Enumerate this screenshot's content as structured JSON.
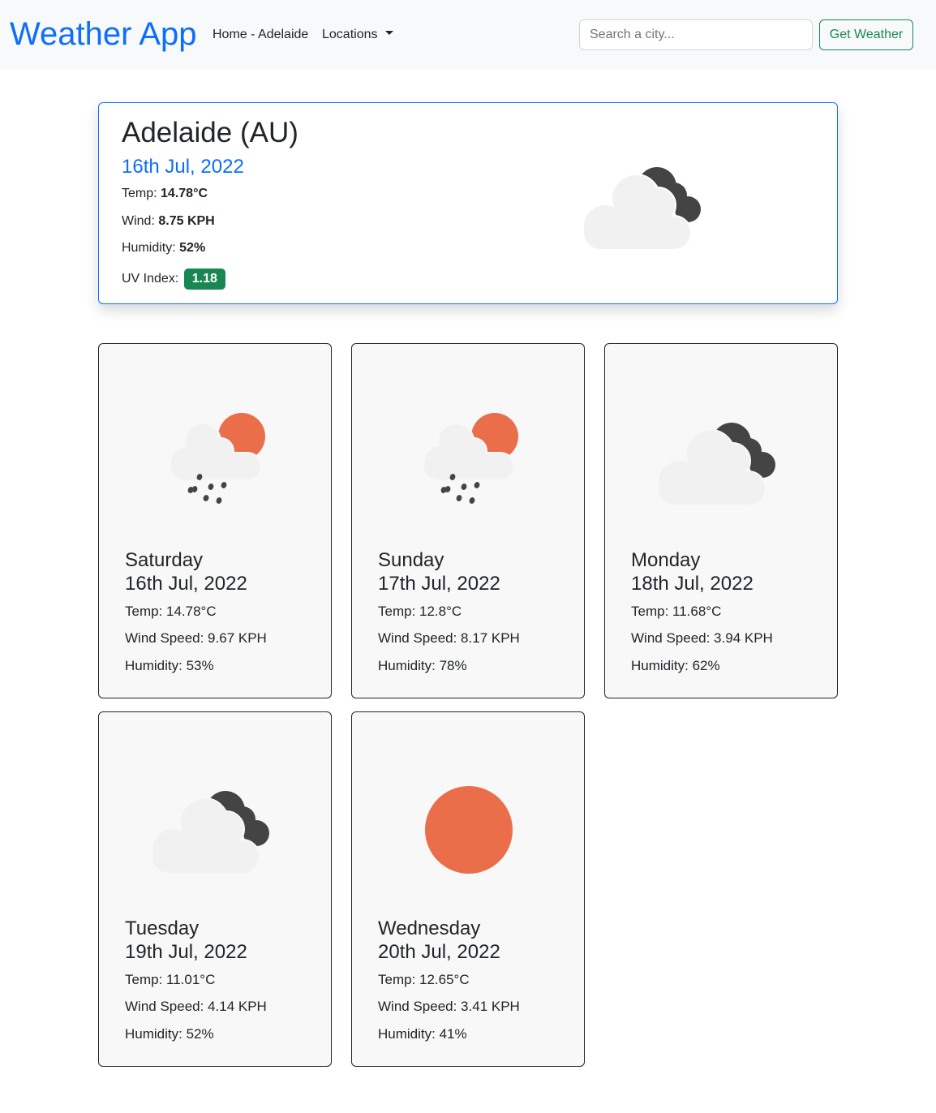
{
  "navbar": {
    "brand": "Weather App",
    "home_label": "Home - Adelaide",
    "locations_label": "Locations",
    "search_placeholder": "Search a city...",
    "button_label": "Get Weather"
  },
  "current": {
    "city": "Adelaide (AU)",
    "date": "16th Jul, 2022",
    "temp_label": "Temp:",
    "temp_value": "14.78°C",
    "wind_label": "Wind:",
    "wind_value": "8.75 KPH",
    "humidity_label": "Humidity:",
    "humidity_value": "52%",
    "uv_label": "UV Index:",
    "uv_value": "1.18",
    "icon": "cloudy-icon"
  },
  "forecast": [
    {
      "day": "Saturday",
      "date": "16th Jul, 2022",
      "temp": "Temp: 14.78°C",
      "wind": "Wind Speed: 9.67 KPH",
      "humidity": "Humidity: 53%",
      "icon": "rain-sun-icon"
    },
    {
      "day": "Sunday",
      "date": "17th Jul, 2022",
      "temp": "Temp: 12.8°C",
      "wind": "Wind Speed: 8.17 KPH",
      "humidity": "Humidity: 78%",
      "icon": "rain-sun-icon"
    },
    {
      "day": "Monday",
      "date": "18th Jul, 2022",
      "temp": "Temp: 11.68°C",
      "wind": "Wind Speed: 3.94 KPH",
      "humidity": "Humidity: 62%",
      "icon": "cloudy-icon"
    },
    {
      "day": "Tuesday",
      "date": "19th Jul, 2022",
      "temp": "Temp: 11.01°C",
      "wind": "Wind Speed: 4.14 KPH",
      "humidity": "Humidity: 52%",
      "icon": "cloudy-icon"
    },
    {
      "day": "Wednesday",
      "date": "20th Jul, 2022",
      "temp": "Temp: 12.65°C",
      "wind": "Wind Speed: 3.41 KPH",
      "humidity": "Humidity: 41%",
      "icon": "sun-icon"
    }
  ],
  "colors": {
    "primary": "#0d6efd",
    "success": "#198754",
    "sun": "#eb6e4b",
    "dark_cloud": "#444444",
    "light_cloud": "#f1f1f1"
  }
}
